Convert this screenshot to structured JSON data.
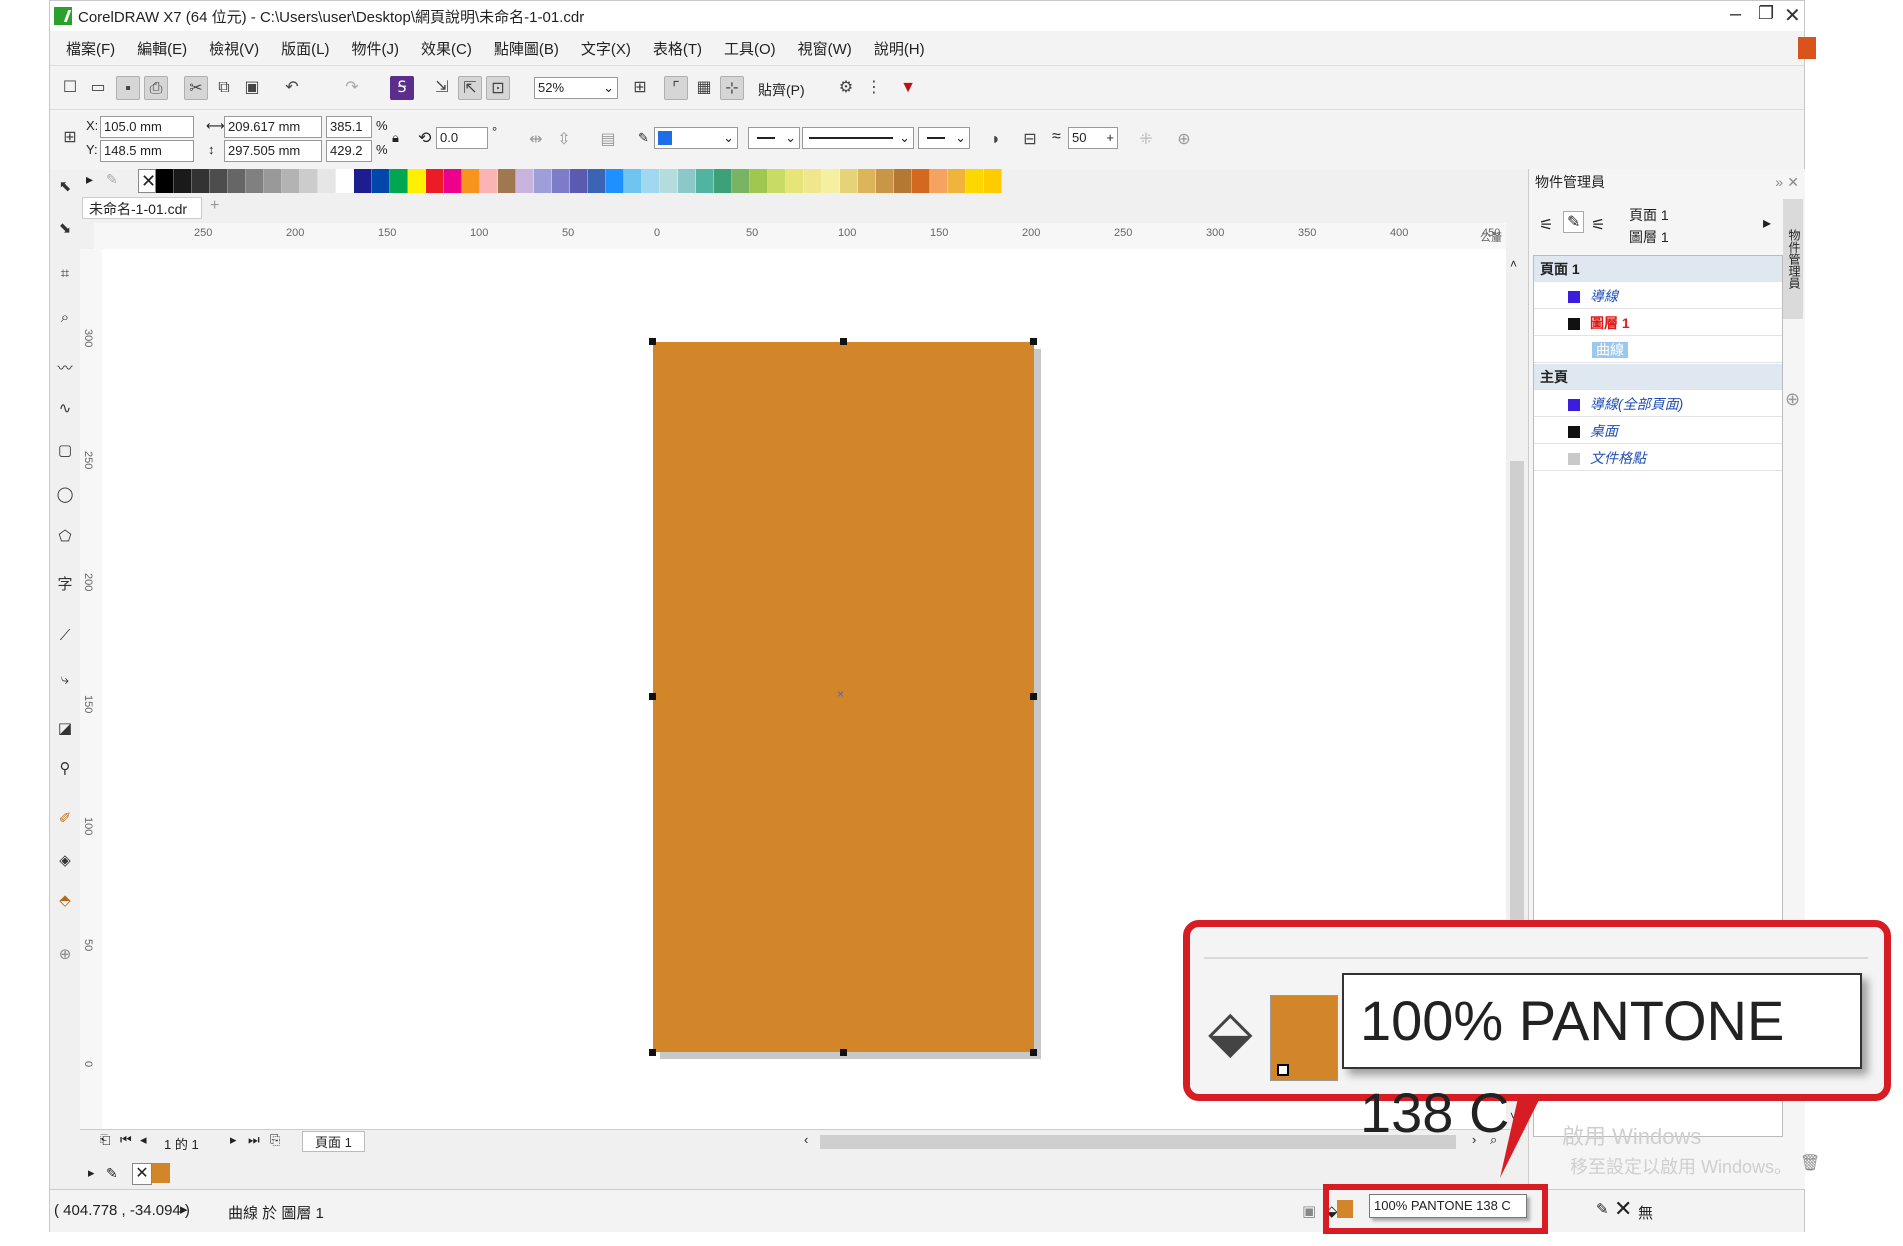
{
  "window": {
    "title": "CorelDRAW X7 (64 位元) - C:\\Users\\user\\Desktop\\網頁說明\\未命名-1-01.cdr"
  },
  "menu": [
    "檔案(F)",
    "編輯(E)",
    "檢視(V)",
    "版面(L)",
    "物件(J)",
    "效果(C)",
    "點陣圖(B)",
    "文字(X)",
    "表格(T)",
    "工具(O)",
    "視窗(W)",
    "說明(H)"
  ],
  "toolbar": {
    "zoom_value": "52%",
    "paste_label": "貼齊(P)"
  },
  "property_bar": {
    "x_label": "X:",
    "x_value": "105.0 mm",
    "y_label": "Y:",
    "y_value": "148.5 mm",
    "width_value": "209.617 mm",
    "height_value": "297.505 mm",
    "scale_w": "385.1",
    "scale_h": "429.2",
    "percent": "%",
    "rotation": "0.0",
    "degree": "°",
    "smooth_value": "50"
  },
  "document": {
    "tab_label": "未命名-1-01.cdr"
  },
  "ruler": {
    "h_ticks": [
      "250",
      "200",
      "150",
      "100",
      "50",
      "0",
      "50",
      "100",
      "150",
      "200",
      "250",
      "300",
      "350",
      "400",
      "450"
    ],
    "h_unit": "公釐",
    "v_ticks": [
      "300",
      "250",
      "200",
      "150",
      "100",
      "50",
      "0"
    ]
  },
  "shape": {
    "fill_color": "#d3852a"
  },
  "page_nav": {
    "counter": "1 的 1",
    "page_tab": "頁面 1"
  },
  "status": {
    "coords": "( 404.778 , -34.094 )",
    "object_info": "曲線 於 圖層 1",
    "fill_text": "100% PANTONE 138 C",
    "outline_text": "無"
  },
  "panel": {
    "title": "物件管理員",
    "current_page": "頁面 1",
    "current_layer": "圖層 1",
    "tree": [
      {
        "label": "頁面 1",
        "kind": "header"
      },
      {
        "label": "導線",
        "color": "#3b1de0",
        "kind": "layer"
      },
      {
        "label": "圖層 1",
        "color": "#111111",
        "kind": "layer-active"
      },
      {
        "label": "曲線",
        "kind": "object"
      },
      {
        "label": "主頁",
        "kind": "header"
      },
      {
        "label": "導線(全部頁面)",
        "color": "#3b1de0",
        "kind": "layer"
      },
      {
        "label": "桌面",
        "color": "#111111",
        "kind": "layer"
      },
      {
        "label": "文件格點",
        "color": "#c9c9c9",
        "kind": "layer"
      }
    ],
    "side_tab": "物件管理員"
  },
  "callout": {
    "text": "100% PANTONE 138 C"
  },
  "watermark": {
    "line1": "啟用 Windows",
    "line2": "移至設定以啟用 Windows。"
  },
  "palette_colors": [
    "#000000",
    "#1a1a1a",
    "#333333",
    "#4d4d4d",
    "#666666",
    "#808080",
    "#999999",
    "#b3b3b3",
    "#cccccc",
    "#e6e6e6",
    "#ffffff",
    "#1d1d8f",
    "#0047ab",
    "#00a651",
    "#ffef00",
    "#ed1c24",
    "#ec008c",
    "#f7941d",
    "#fbb4b4",
    "#a07850",
    "#c8b4dc",
    "#9e9ed8",
    "#7c7cc8",
    "#5a5ab0",
    "#3c64b4",
    "#1e90ff",
    "#6ec6f0",
    "#a0d8f0",
    "#b4dcdc",
    "#8cc8c8",
    "#50b4a0",
    "#3ca078",
    "#78b464",
    "#a0c850",
    "#c8dc64",
    "#e6e678",
    "#f0e68c",
    "#f5f0a0",
    "#e6d278",
    "#dcb45a",
    "#c89646",
    "#b47832",
    "#d2691e",
    "#f4a460",
    "#f0b43c",
    "#ffd700",
    "#ffcc00"
  ]
}
